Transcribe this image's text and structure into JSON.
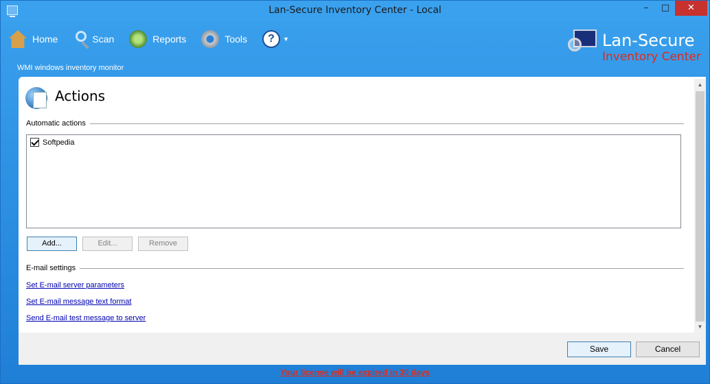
{
  "window": {
    "title": "Lan-Secure Inventory Center - Local",
    "min_glyph": "–",
    "max_glyph": "□",
    "close_glyph": "✕"
  },
  "toolbar": {
    "home": "Home",
    "scan": "Scan",
    "reports": "Reports",
    "tools": "Tools",
    "help_glyph": "?",
    "help_arrow": "▼"
  },
  "subtitle": "WMI windows inventory monitor",
  "brand": {
    "name": "Lan-Secure",
    "sub": "Inventory Center"
  },
  "page": {
    "title": "Actions",
    "automatic_actions_label": "Automatic actions",
    "actions_list": [
      {
        "label": "Softpedia",
        "checked": true
      }
    ],
    "add_button": "Add...",
    "edit_button": "Edit...",
    "remove_button": "Remove",
    "email_label": "E-mail settings",
    "links": {
      "server": "Set E-mail server parameters",
      "format": "Set E-mail message text format",
      "test": "Send E-mail test message to server"
    }
  },
  "footer": {
    "save": "Save",
    "cancel": "Cancel"
  },
  "license": "Your license will be expired in 30 days",
  "colors": {
    "background": "#2b8fe0",
    "close_button": "#c7312e",
    "brand_sub": "#e02a1c",
    "link": "#0000b0"
  }
}
